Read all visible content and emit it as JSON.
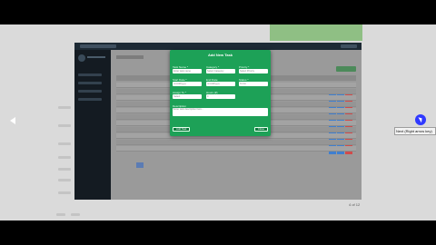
{
  "modal": {
    "title": "Add New Task",
    "fields": [
      {
        "label": "Task Name *",
        "placeholder": "Enter task name"
      },
      {
        "label": "Category *",
        "placeholder": "Select Category"
      },
      {
        "label": "Priority *",
        "placeholder": "Select Priority"
      },
      {
        "label": "Start Date *",
        "placeholder": "mm/dd/yyyy"
      },
      {
        "label": "End Date",
        "placeholder": "mm/dd/yyyy"
      },
      {
        "label": "Status *",
        "placeholder": "To Do"
      },
      {
        "label": "Assign To *",
        "placeholder": "Select"
      },
      {
        "label": "Hours (#)",
        "placeholder": "0"
      }
    ],
    "description": {
      "label": "Description",
      "placeholder": "Enter task description here..."
    },
    "add_button": "Add Task",
    "close_button": "Close"
  },
  "tooltip": "Next (Right arrow key)",
  "page_counter": "4 of 12",
  "colors": {
    "modal": "#1da157",
    "sidebar": "#141b22",
    "overlay": "#8f8f8f",
    "cursor": "#2f39ff",
    "action_blue": "#3f7fd0",
    "action_red": "#d14b4b"
  },
  "icons": {
    "prev": "chevron-left-icon",
    "cursor": "mouse-cursor-icon"
  }
}
